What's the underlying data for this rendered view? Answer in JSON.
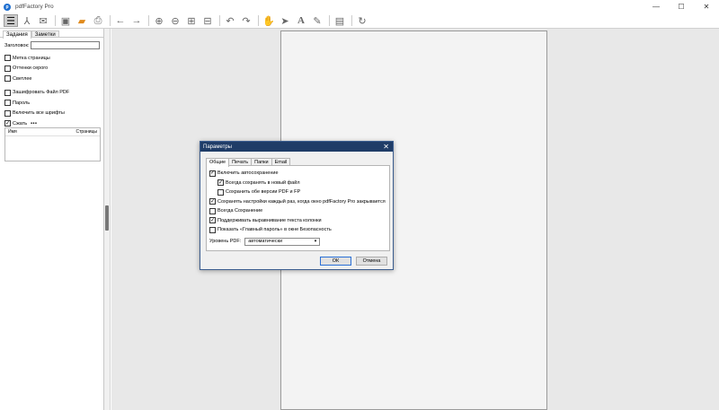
{
  "window": {
    "title": "pdfFactory Pro",
    "minimize": "—",
    "maximize": "☐",
    "close": "✕"
  },
  "toolbar": {
    "icons": [
      "menu-icon",
      "email-icon",
      "save-icon",
      "open-folder-icon",
      "print-icon",
      "back-arrow-icon",
      "forward-arrow-icon",
      "zoom-in-icon",
      "zoom-out-icon",
      "fit-page-icon",
      "fit-width-icon",
      "undo-icon",
      "redo-icon",
      "hand-icon",
      "pointer-icon",
      "text-icon",
      "edit-icon",
      "page-icon",
      "refresh-icon"
    ]
  },
  "leftpanel": {
    "tabs": [
      "Задания",
      "Заметки"
    ],
    "title_label": "Заголовок:",
    "title_value": "",
    "options": [
      {
        "label": "Метка страницы",
        "checked": false
      },
      {
        "label": "Оттенки серого",
        "checked": false
      },
      {
        "label": "Светлее",
        "checked": false
      },
      {
        "label": "Зашифровать Файл PDF",
        "checked": false
      },
      {
        "label": "Пароль",
        "checked": false
      },
      {
        "label": "Включить все шрифты",
        "checked": false
      },
      {
        "label": "Сжать",
        "checked": true
      }
    ],
    "more": "•••",
    "list_columns": [
      "Имя",
      "Страницы"
    ]
  },
  "dialog": {
    "title": "Параметры",
    "close": "✕",
    "tabs": [
      "Общие",
      "Печать",
      "Папки",
      "Email"
    ],
    "options": [
      {
        "label": "Включить автосохранение",
        "checked": true,
        "indent": false
      },
      {
        "label": "Всегда сохранять в новый файл",
        "checked": true,
        "indent": true
      },
      {
        "label": "Сохранить обе версии PDF и FP",
        "checked": false,
        "indent": true
      },
      {
        "label": "Сохранять настройки каждый раз, когда окно pdfFactory Pro закрывается",
        "checked": true,
        "indent": false
      },
      {
        "label": "Всегда Сохранение",
        "checked": false,
        "indent": false
      },
      {
        "label": "Поддерживать выравнивание текста колонки",
        "checked": true,
        "indent": false
      },
      {
        "label": "Показать «Главный пароль» в окне Безопасность",
        "checked": false,
        "indent": false
      }
    ],
    "pdf_level_label": "Уровень PDF:",
    "pdf_level_value": "автоматически",
    "ok": "ОК",
    "cancel": "Отмена"
  }
}
